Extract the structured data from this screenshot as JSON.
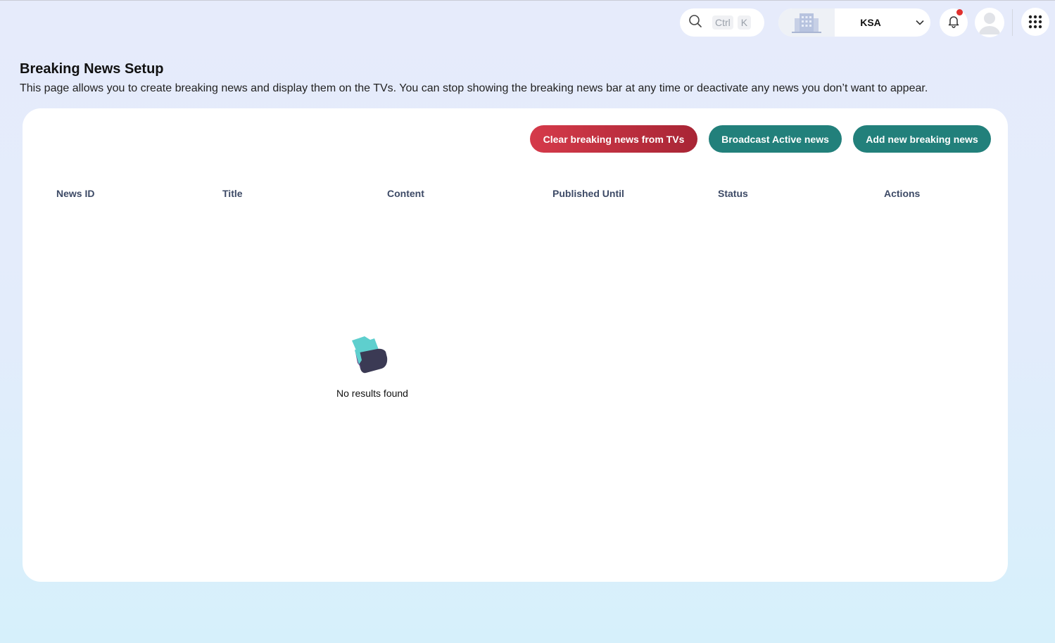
{
  "topbar": {
    "search_shortcut_ctrl": "Ctrl",
    "search_shortcut_key": "K",
    "tenant_name": "KSA"
  },
  "page": {
    "title": "Breaking News Setup",
    "description": "This page allows you to create breaking news and display them on the TVs. You can stop showing the breaking news bar at any time or deactivate any news you don’t want to appear."
  },
  "actions": {
    "clear_label": "Clear breaking news from TVs",
    "broadcast_label": "Broadcast Active news",
    "add_label": "Add new breaking news"
  },
  "table": {
    "columns": [
      "News ID",
      "Title",
      "Content",
      "Published Until",
      "Status",
      "Actions"
    ],
    "rows": [],
    "empty_text": "No results found"
  },
  "colors": {
    "danger": "#c22f40",
    "primary": "#22807b",
    "notification_dot": "#e0312f"
  }
}
